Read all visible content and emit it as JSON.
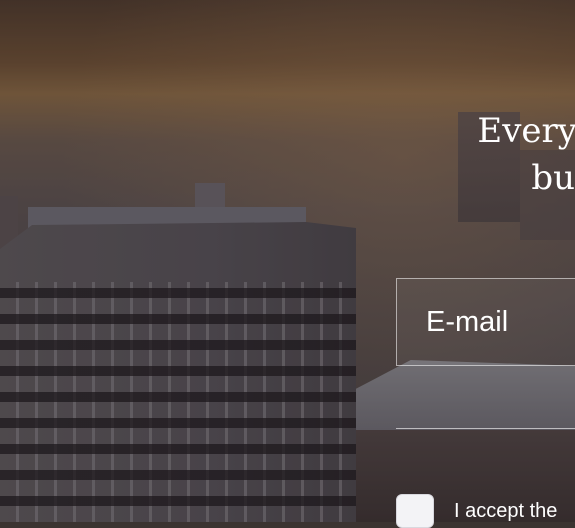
{
  "hero": {
    "headline_line1": "Every",
    "headline_line2": "bu"
  },
  "form": {
    "email_placeholder": "E-mail",
    "consent_label": "I accept the"
  },
  "colors": {
    "text": "#ffffff",
    "field_border": "#c8c6c6",
    "checkbox_bg": "#f3f3f6"
  }
}
